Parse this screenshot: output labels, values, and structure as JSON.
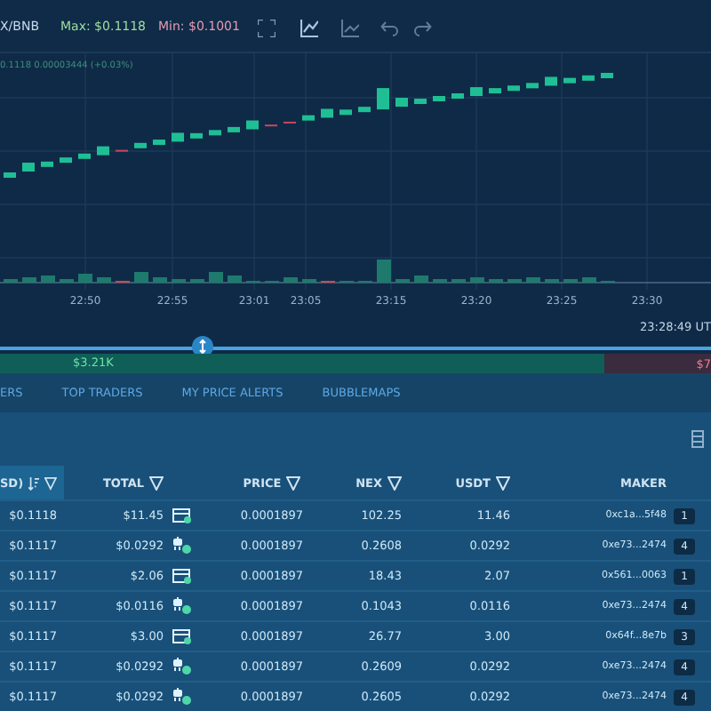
{
  "toolbar": {
    "pair": "X/BNB",
    "max": "Max: $0.1118",
    "min": "Min: $0.1001"
  },
  "chart": {
    "legend": "0.1118  0.00003444 (+0.03%)",
    "time_labels": [
      "22:50",
      "22:55",
      "23:01",
      "23:05",
      "23:15",
      "23:20",
      "23:25",
      "23:30"
    ],
    "clock": "23:28:49 UT"
  },
  "pressure": {
    "buy": "$3.21K",
    "sell": "$7",
    "level": 0.85
  },
  "tabs": [
    {
      "label": "ERS",
      "selected": false
    },
    {
      "label": "TOP TRADERS",
      "selected": false
    },
    {
      "label": "MY PRICE ALERTS",
      "selected": false
    },
    {
      "label": "BUBBLEMAPS",
      "selected": false
    }
  ],
  "table": {
    "columns": [
      "SD)",
      "TOTAL",
      "PRICE",
      "NEX",
      "USDT",
      "MAKER"
    ],
    "rows": [
      {
        "price_usd": "$0.1118",
        "total": "$11.45",
        "kind": "wallet",
        "price": "0.0001897",
        "nex": "102.25",
        "usdt": "11.46",
        "maker": "0xc1a...5f48",
        "count": "1"
      },
      {
        "price_usd": "$0.1117",
        "total": "$0.0292",
        "kind": "bot",
        "price": "0.0001897",
        "nex": "0.2608",
        "usdt": "0.0292",
        "maker": "0xe73...2474",
        "count": "4"
      },
      {
        "price_usd": "$0.1117",
        "total": "$2.06",
        "kind": "wallet",
        "price": "0.0001897",
        "nex": "18.43",
        "usdt": "2.07",
        "maker": "0x561...0063",
        "count": "1"
      },
      {
        "price_usd": "$0.1117",
        "total": "$0.0116",
        "kind": "bot",
        "price": "0.0001897",
        "nex": "0.1043",
        "usdt": "0.0116",
        "maker": "0xe73...2474",
        "count": "4"
      },
      {
        "price_usd": "$0.1117",
        "total": "$3.00",
        "kind": "wallet",
        "price": "0.0001897",
        "nex": "26.77",
        "usdt": "3.00",
        "maker": "0x64f...8e7b",
        "count": "3"
      },
      {
        "price_usd": "$0.1117",
        "total": "$0.0292",
        "kind": "bot",
        "price": "0.0001897",
        "nex": "0.2609",
        "usdt": "0.0292",
        "maker": "0xe73...2474",
        "count": "4"
      },
      {
        "price_usd": "$0.1117",
        "total": "$0.0292",
        "kind": "bot",
        "price": "0.0001897",
        "nex": "0.2605",
        "usdt": "0.0292",
        "maker": "0xe73...2474",
        "count": "4"
      }
    ]
  }
}
